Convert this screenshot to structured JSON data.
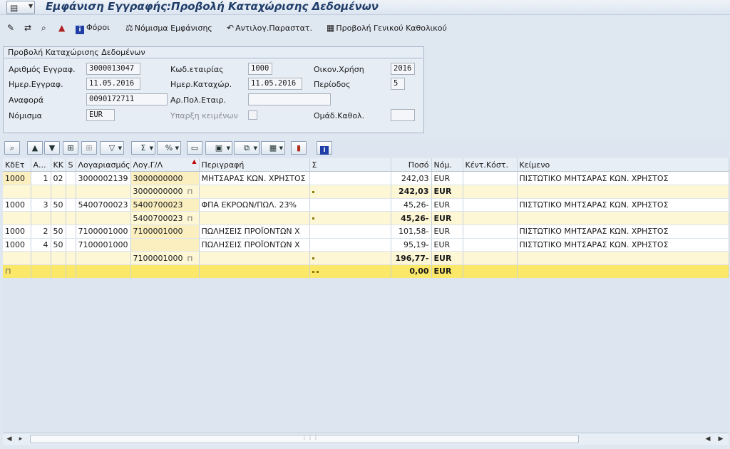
{
  "window": {
    "title": "Εμφάνιση Εγγραφής:Προβολή Καταχώρισης Δεδομένων"
  },
  "app_toolbar": {
    "taxes": "Φόροι",
    "display_currency": "Νόμισμα Εμφάνισης",
    "reversal_doc": "Αντιλογ.Παραστατ.",
    "gl_view": "Προβολή Γενικού Καθολικού"
  },
  "header_group": {
    "title": "Προβολή Καταχώρισης Δεδομένων",
    "doc_number_label": "Αριθμός Εγγραφ.",
    "doc_number": "3000013047",
    "company_code_label": "Κωδ.εταιρίας",
    "company_code": "1000",
    "fiscal_year_label": "Οικον.Χρήση",
    "fiscal_year": "2016",
    "doc_date_label": "Ημερ.Εγγραφ.",
    "doc_date": "11.05.2016",
    "posting_date_label": "Ημερ.Καταχώρ.",
    "posting_date": "11.05.2016",
    "period_label": "Περίοδος",
    "period": "5",
    "reference_label": "Αναφορά",
    "reference": "0090172711",
    "cross_company_label": "Αρ.Πολ.Εταιρ.",
    "cross_company": "",
    "currency_label": "Νόμισμα",
    "currency": "EUR",
    "texts_exist_label": "Υπαρξη κειμένων",
    "ledger_group_label": "Ομάδ.Καθολ.",
    "ledger_group": ""
  },
  "grid": {
    "columns": [
      "ΚδΕτ",
      "Α...",
      "ΚΚ",
      "S",
      "Λογαριασμός",
      "Λογ.Γ/Λ",
      "Περιγραφή",
      "Σ",
      "Ποσό",
      "Νόμ.",
      "Κέντ.Κόστ.",
      "Κείμενο"
    ],
    "rows": [
      {
        "type": "data",
        "cc": "1000",
        "item": "1",
        "pk": "02",
        "s": "",
        "account": "3000002139",
        "gl": "3000000000",
        "desc": "ΜΗΤΣΑΡΑΣ ΚΩΝ. ΧΡΗΣΤΟΣ",
        "amount": "242,03",
        "curr": "EUR",
        "cost_center": "",
        "text": "ΠΙΣΤΩΤΙΚΟ ΜΗΤΣΑΡΑΣ ΚΩΝ. ΧΡΗΣΤΟΣ"
      },
      {
        "type": "sub",
        "gl": "3000000000",
        "amount": "242,03",
        "curr": "EUR"
      },
      {
        "type": "data",
        "cc": "1000",
        "item": "3",
        "pk": "50",
        "s": "",
        "account": "5400700023",
        "gl": "5400700023",
        "desc": "ΦΠΑ ΕΚΡΟΩΝ/ΠΩΛ. 23%",
        "amount": "45,26-",
        "curr": "EUR",
        "cost_center": "",
        "text": "ΠΙΣΤΩΤΙΚΟ ΜΗΤΣΑΡΑΣ ΚΩΝ. ΧΡΗΣΤΟΣ"
      },
      {
        "type": "sub",
        "gl": "5400700023",
        "amount": "45,26-",
        "curr": "EUR"
      },
      {
        "type": "data",
        "cc": "1000",
        "item": "2",
        "pk": "50",
        "s": "",
        "account": "7100001000",
        "gl": "7100001000",
        "desc": "ΠΩΛΗΣΕΙΣ ΠΡΟΪΟΝΤΩΝ Χ",
        "amount": "101,58-",
        "curr": "EUR",
        "cost_center": "",
        "text": "ΠΙΣΤΩΤΙΚΟ ΜΗΤΣΑΡΑΣ ΚΩΝ. ΧΡΗΣΤΟΣ"
      },
      {
        "type": "data",
        "cc": "1000",
        "item": "4",
        "pk": "50",
        "s": "",
        "account": "7100001000",
        "gl": "",
        "desc": "ΠΩΛΗΣΕΙΣ ΠΡΟΪΟΝΤΩΝ Χ",
        "amount": "95,19-",
        "curr": "EUR",
        "cost_center": "",
        "text": "ΠΙΣΤΩΤΙΚΟ ΜΗΤΣΑΡΑΣ ΚΩΝ. ΧΡΗΣΤΟΣ"
      },
      {
        "type": "sub",
        "gl": "7100001000",
        "amount": "196,77-",
        "curr": "EUR"
      },
      {
        "type": "total",
        "amount": "0,00",
        "curr": "EUR"
      }
    ]
  }
}
